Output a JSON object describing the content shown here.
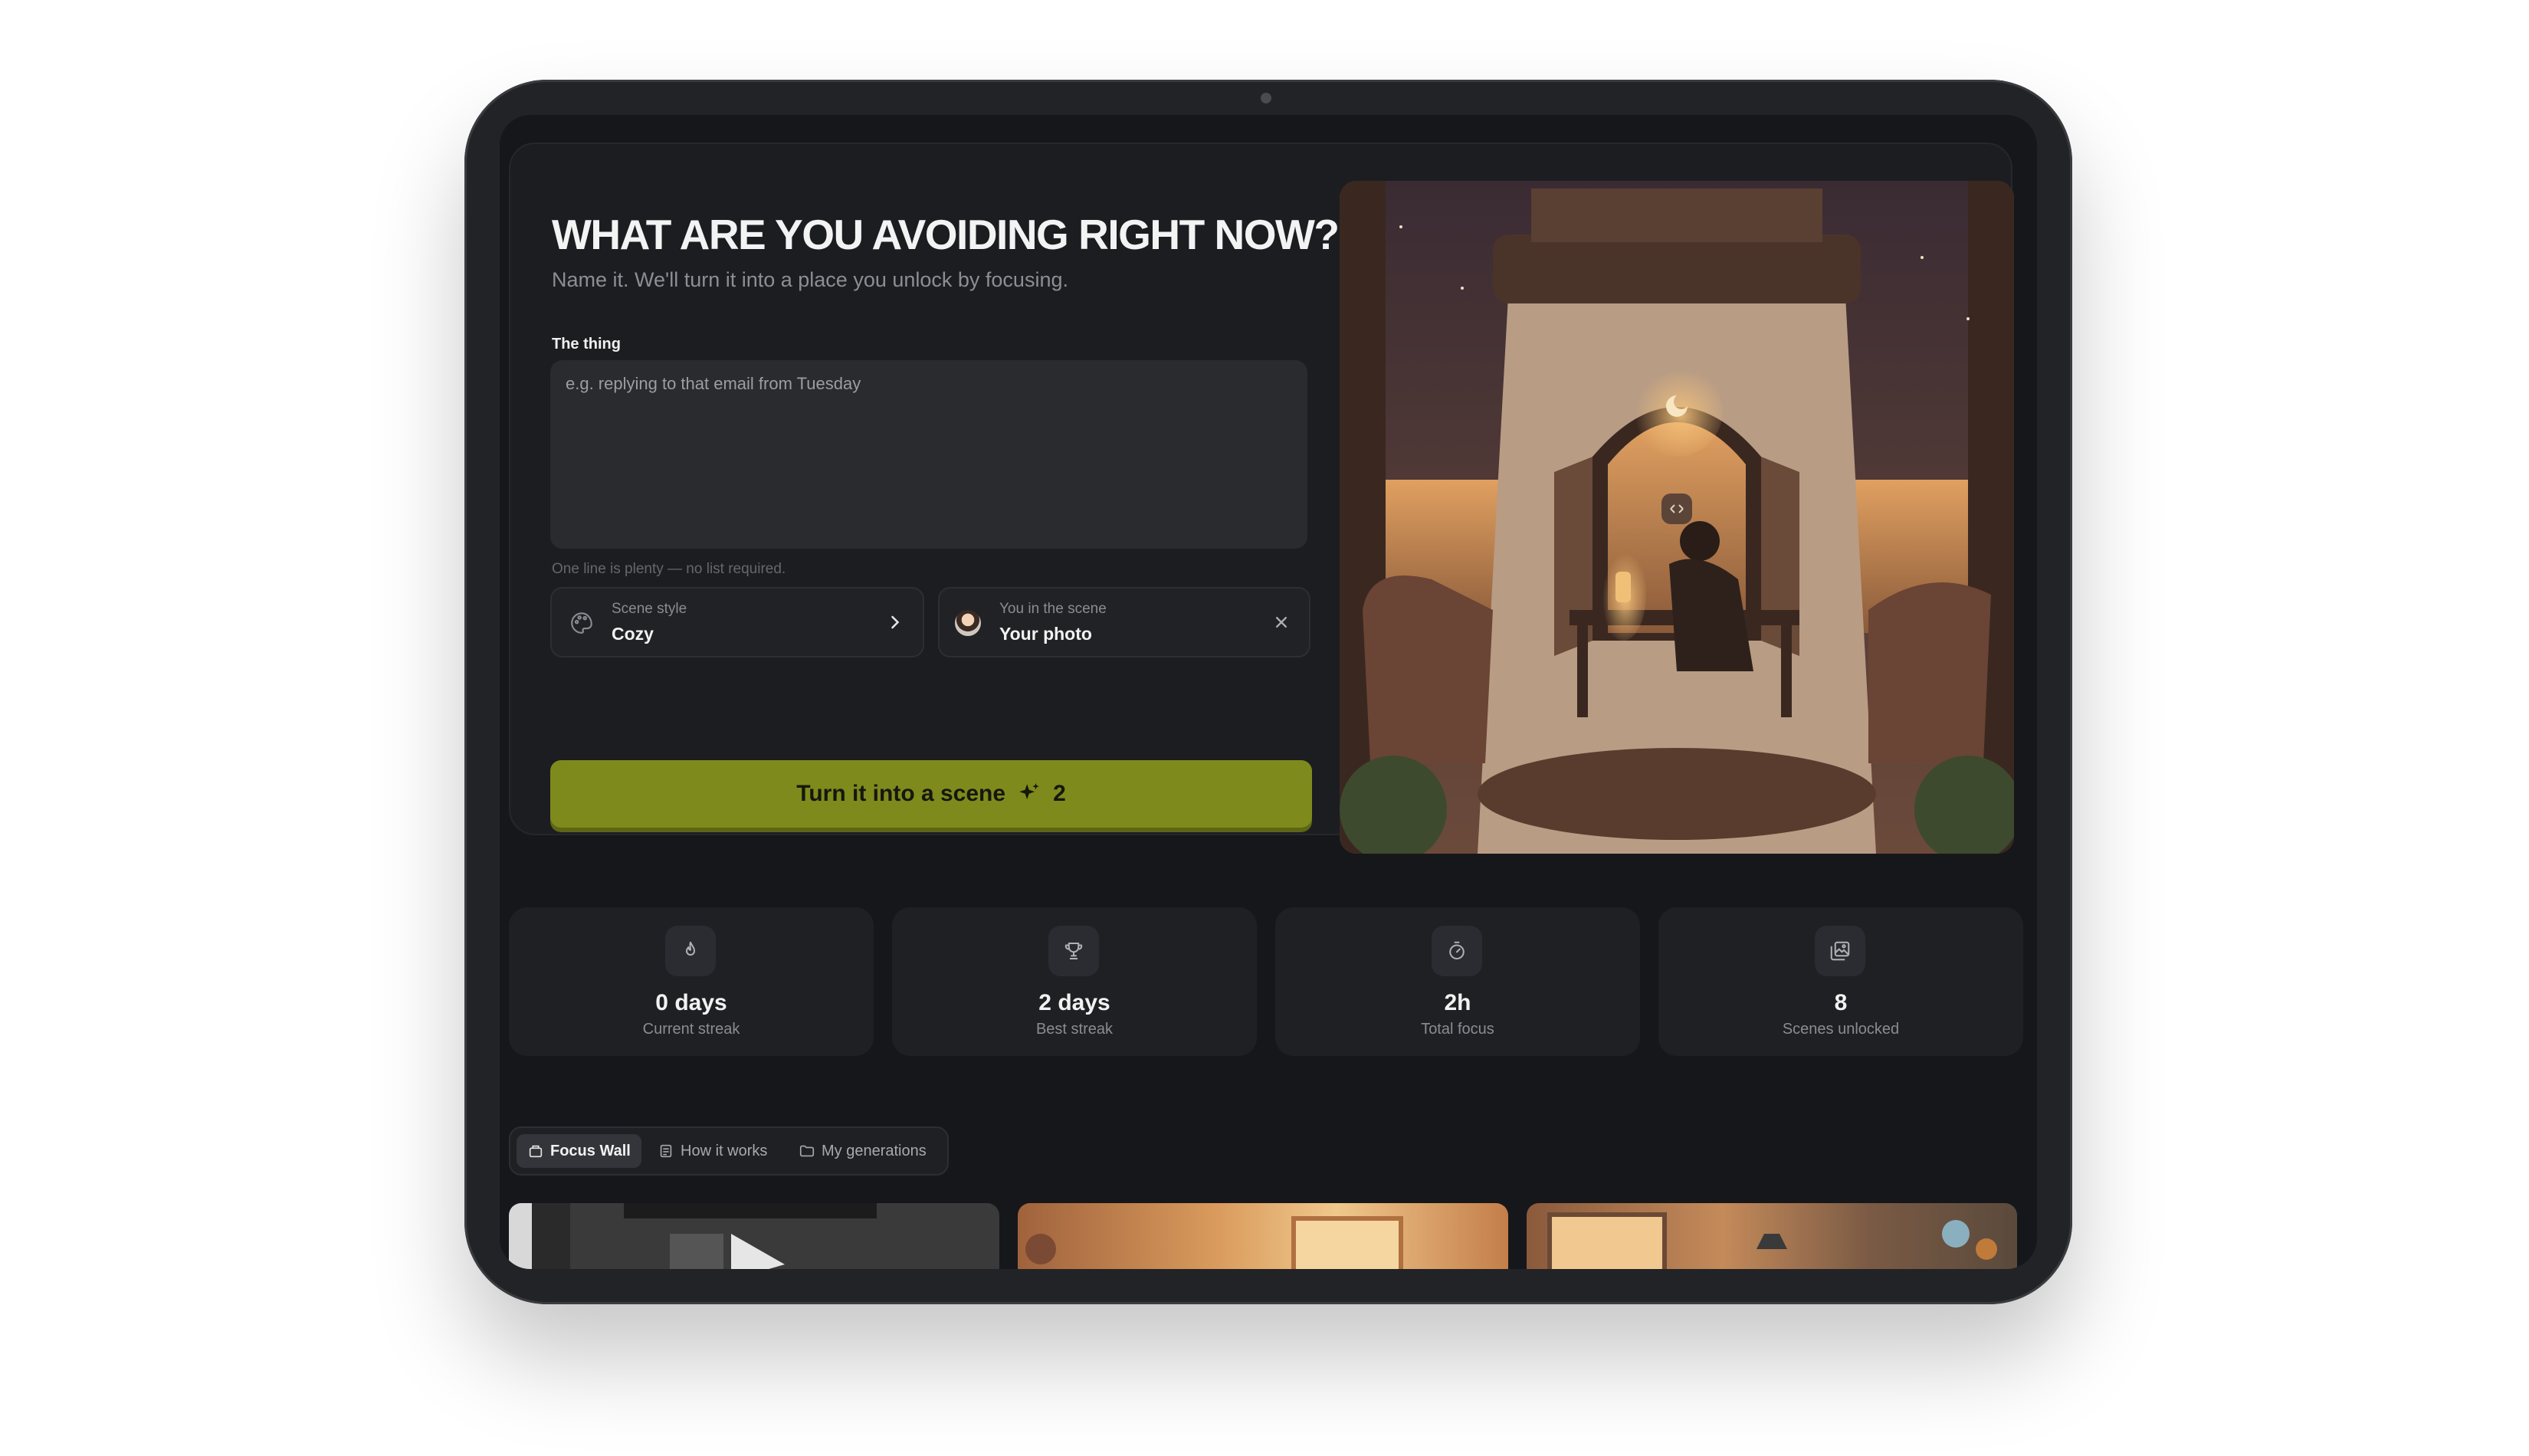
{
  "hero": {
    "title": "WHAT ARE YOU AVOIDING RIGHT NOW?",
    "subtitle": "Name it. We'll turn it into a place you unlock by focusing.",
    "field_label": "The thing",
    "placeholder": "e.g. replying to that email from Tuesday",
    "value": "",
    "hint": "One line is plenty — no list required."
  },
  "options": {
    "scene_style": {
      "label": "Scene style",
      "value": "Cozy",
      "icon": "palette-icon",
      "action_icon": "chevron-right-icon"
    },
    "you_in_scene": {
      "label": "You in the scene",
      "value": "Your photo",
      "icon": "avatar",
      "action_icon": "close-icon"
    }
  },
  "cta": {
    "label": "Turn it into a scene",
    "icon": "sparkle-icon",
    "credits": "2"
  },
  "stats": [
    {
      "value": "0 days",
      "label": "Current streak",
      "icon": "flame-icon"
    },
    {
      "value": "2 days",
      "label": "Best streak",
      "icon": "trophy-icon"
    },
    {
      "value": "2h",
      "label": "Total focus",
      "icon": "stopwatch-icon"
    },
    {
      "value": "8",
      "label": "Scenes unlocked",
      "icon": "gallery-icon"
    }
  ],
  "tabs": [
    {
      "label": "Focus Wall",
      "icon": "frame-icon",
      "active": true
    },
    {
      "label": "How it works",
      "icon": "document-icon",
      "active": false
    },
    {
      "label": "My generations",
      "icon": "folder-icon",
      "active": false
    }
  ],
  "colors": {
    "accent": "#7e8a1c",
    "background": "#16171a",
    "panel": "#1c1d21",
    "card": "#1f2024"
  }
}
